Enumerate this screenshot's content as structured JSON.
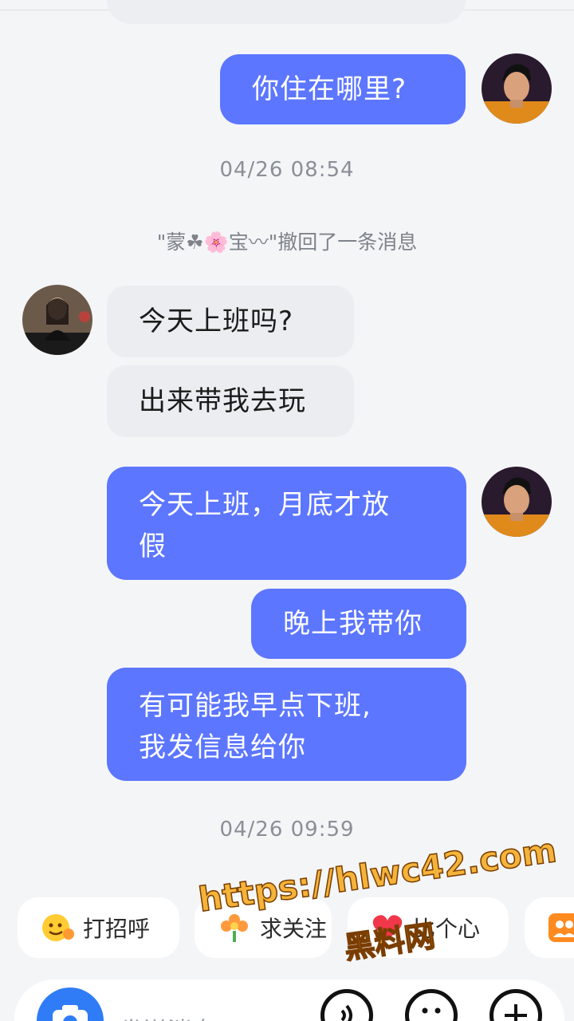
{
  "chat": {
    "messages": [
      {
        "from": "me",
        "text": "你住在哪里?"
      },
      {
        "type": "timestamp",
        "text": "04/26 08:54"
      },
      {
        "type": "recall",
        "text": "\"蒙☘🌸宝〰\"撤回了一条消息"
      },
      {
        "from": "them",
        "text": "今天上班吗?"
      },
      {
        "from": "them",
        "text": "出来带我去玩"
      },
      {
        "from": "me",
        "line1": "今天上班，月底才放",
        "line2": "假"
      },
      {
        "from": "me",
        "text": "晚上我带你"
      },
      {
        "from": "me",
        "line1": "有可能我早点下班,",
        "line2": "我发信息给你"
      },
      {
        "type": "timestamp",
        "text": "04/26 09:59"
      }
    ]
  },
  "quick_actions": [
    {
      "label": "打招呼",
      "icon": "wave-emoji-icon"
    },
    {
      "label": "求关注",
      "icon": "flower-icon"
    },
    {
      "label": "比个心",
      "icon": "heart-icon"
    },
    {
      "label": "",
      "icon": "group-icon"
    }
  ],
  "input": {
    "placeholder": "发送消息",
    "icons": [
      "camera-icon",
      "voice-icon",
      "emoji-icon",
      "plus-icon"
    ]
  },
  "watermark": {
    "line1": "https://hlwc42.com",
    "line2": "黑料网"
  },
  "colors": {
    "my_bubble": "#5c76ff",
    "their_bubble": "#ebedf0",
    "background": "#f4f5f7",
    "timestamp": "#8a8f97"
  }
}
